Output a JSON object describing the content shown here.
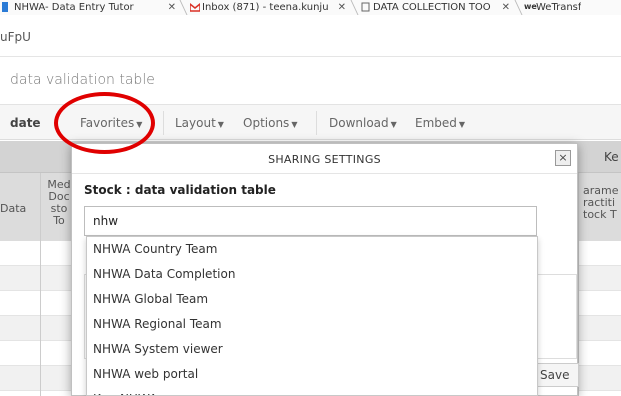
{
  "browser": {
    "tabs": [
      {
        "label": "NHWA- Data Entry Tutor",
        "icon": "doc-icon"
      },
      {
        "label": "Inbox (871) - teena.kunju",
        "icon": "gmail-icon"
      },
      {
        "label": "DATA COLLECTION TOO",
        "icon": "file-icon"
      },
      {
        "label": "WeTransf",
        "icon": "wetransfer-icon"
      }
    ],
    "address_fragment": "uFpU"
  },
  "page": {
    "favorite_title": "data validation table"
  },
  "menu": {
    "update_label": "date",
    "favorites_label": "Favorites",
    "layout_label": "Layout",
    "options_label": "Options",
    "download_label": "Download",
    "embed_label": "Embed"
  },
  "table": {
    "right_header": "Ke",
    "left_col": "Data",
    "col2": [
      "Med",
      "Doc",
      "sto",
      "To"
    ],
    "right_col": [
      "arame",
      "ractiti",
      "tock T"
    ]
  },
  "dialog": {
    "title": "SHARING SETTINGS",
    "close_label": "×",
    "subtitle": "Stock : data validation table",
    "search_value": "nhw",
    "save_label": "Save",
    "suggestions": [
      "NHWA Country Team",
      "NHWA Data Completion",
      "NHWA Global Team",
      "NHWA Regional Team",
      "NHWA System viewer",
      "NHWA web portal",
      "K.... NHWA"
    ]
  },
  "colors": {
    "annotation": "#e00000",
    "menubar": "#f6f6f6",
    "table_header": "#d3d3d3"
  }
}
